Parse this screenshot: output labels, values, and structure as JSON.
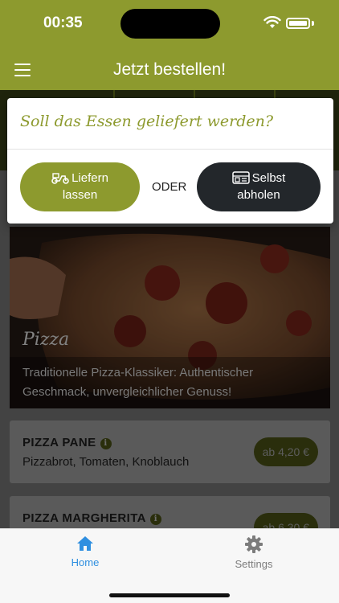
{
  "status_bar": {
    "time": "00:35"
  },
  "app_bar": {
    "title": "Jetzt bestellen!"
  },
  "modal": {
    "title": "Soll das Essen geliefert werden?",
    "deliver_line1": "Liefern",
    "deliver_line2": "lassen",
    "or_label": "ODER",
    "pickup_line1": "Selbst",
    "pickup_line2": "abholen"
  },
  "category": {
    "name": "Pizza",
    "description": "Traditionelle Pizza-Klassiker: Authentischer Geschmack, unvergleichlicher Genuss!"
  },
  "items": [
    {
      "name": "PIZZA PANE",
      "description": "Pizzabrot, Tomaten, Knoblauch",
      "price": "ab 4,20 €"
    },
    {
      "name": "PIZZA MARGHERITA",
      "description": "",
      "price": "ab 6,30 €"
    }
  ],
  "tab_bar": {
    "home_label": "Home",
    "settings_label": "Settings"
  },
  "icons": {
    "menu": "menu-icon",
    "wifi": "wifi-icon",
    "battery": "battery-icon",
    "scooter": "scooter-icon",
    "store": "store-icon",
    "info": "info-icon",
    "home": "home-icon",
    "settings": "gear-icon"
  },
  "colors": {
    "accent": "#8d9a2e",
    "dark_button": "#23272b",
    "active_tab": "#2f8fe0"
  }
}
